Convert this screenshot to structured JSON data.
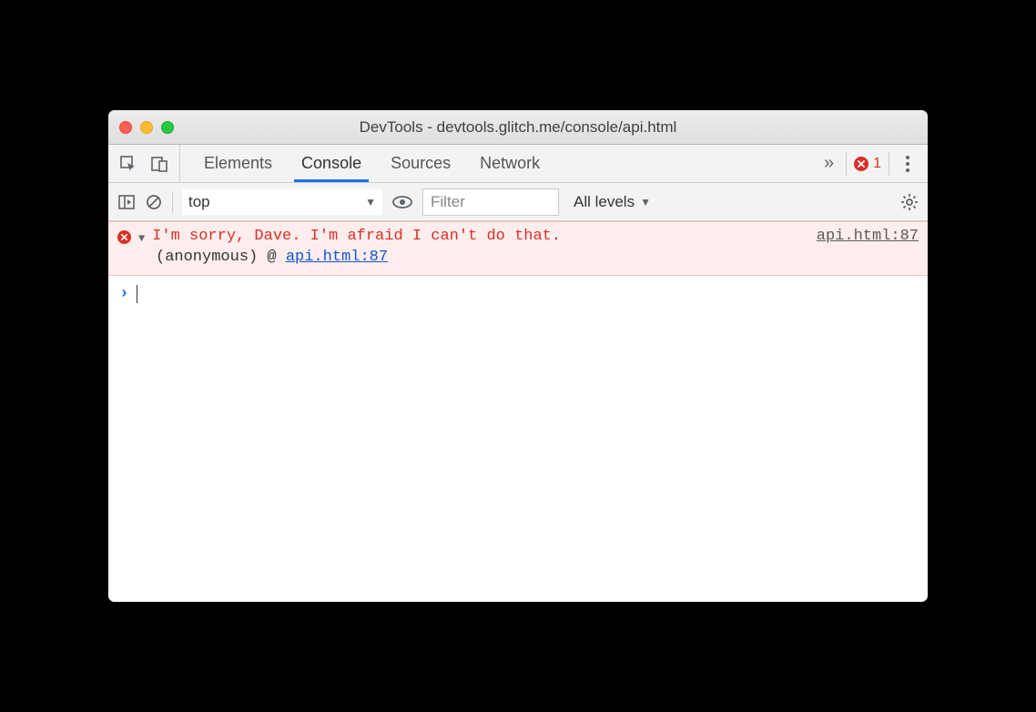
{
  "window": {
    "title": "DevTools - devtools.glitch.me/console/api.html"
  },
  "tabs": {
    "items": [
      "Elements",
      "Console",
      "Sources",
      "Network"
    ],
    "active_index": 1,
    "overflow_glyph": "»"
  },
  "error_indicator": {
    "count": "1"
  },
  "toolbar": {
    "context": "top",
    "filter_placeholder": "Filter",
    "filter_value": "",
    "levels_label": "All levels"
  },
  "console": {
    "error": {
      "message": "I'm sorry, Dave. I'm afraid I can't do that.",
      "source_link": "api.html:87",
      "trace_function": "(anonymous)",
      "trace_at": "@",
      "trace_link": "api.html:87"
    }
  },
  "colors": {
    "error": "#d93025",
    "link": "#1155cc",
    "accent": "#1a73e8"
  }
}
